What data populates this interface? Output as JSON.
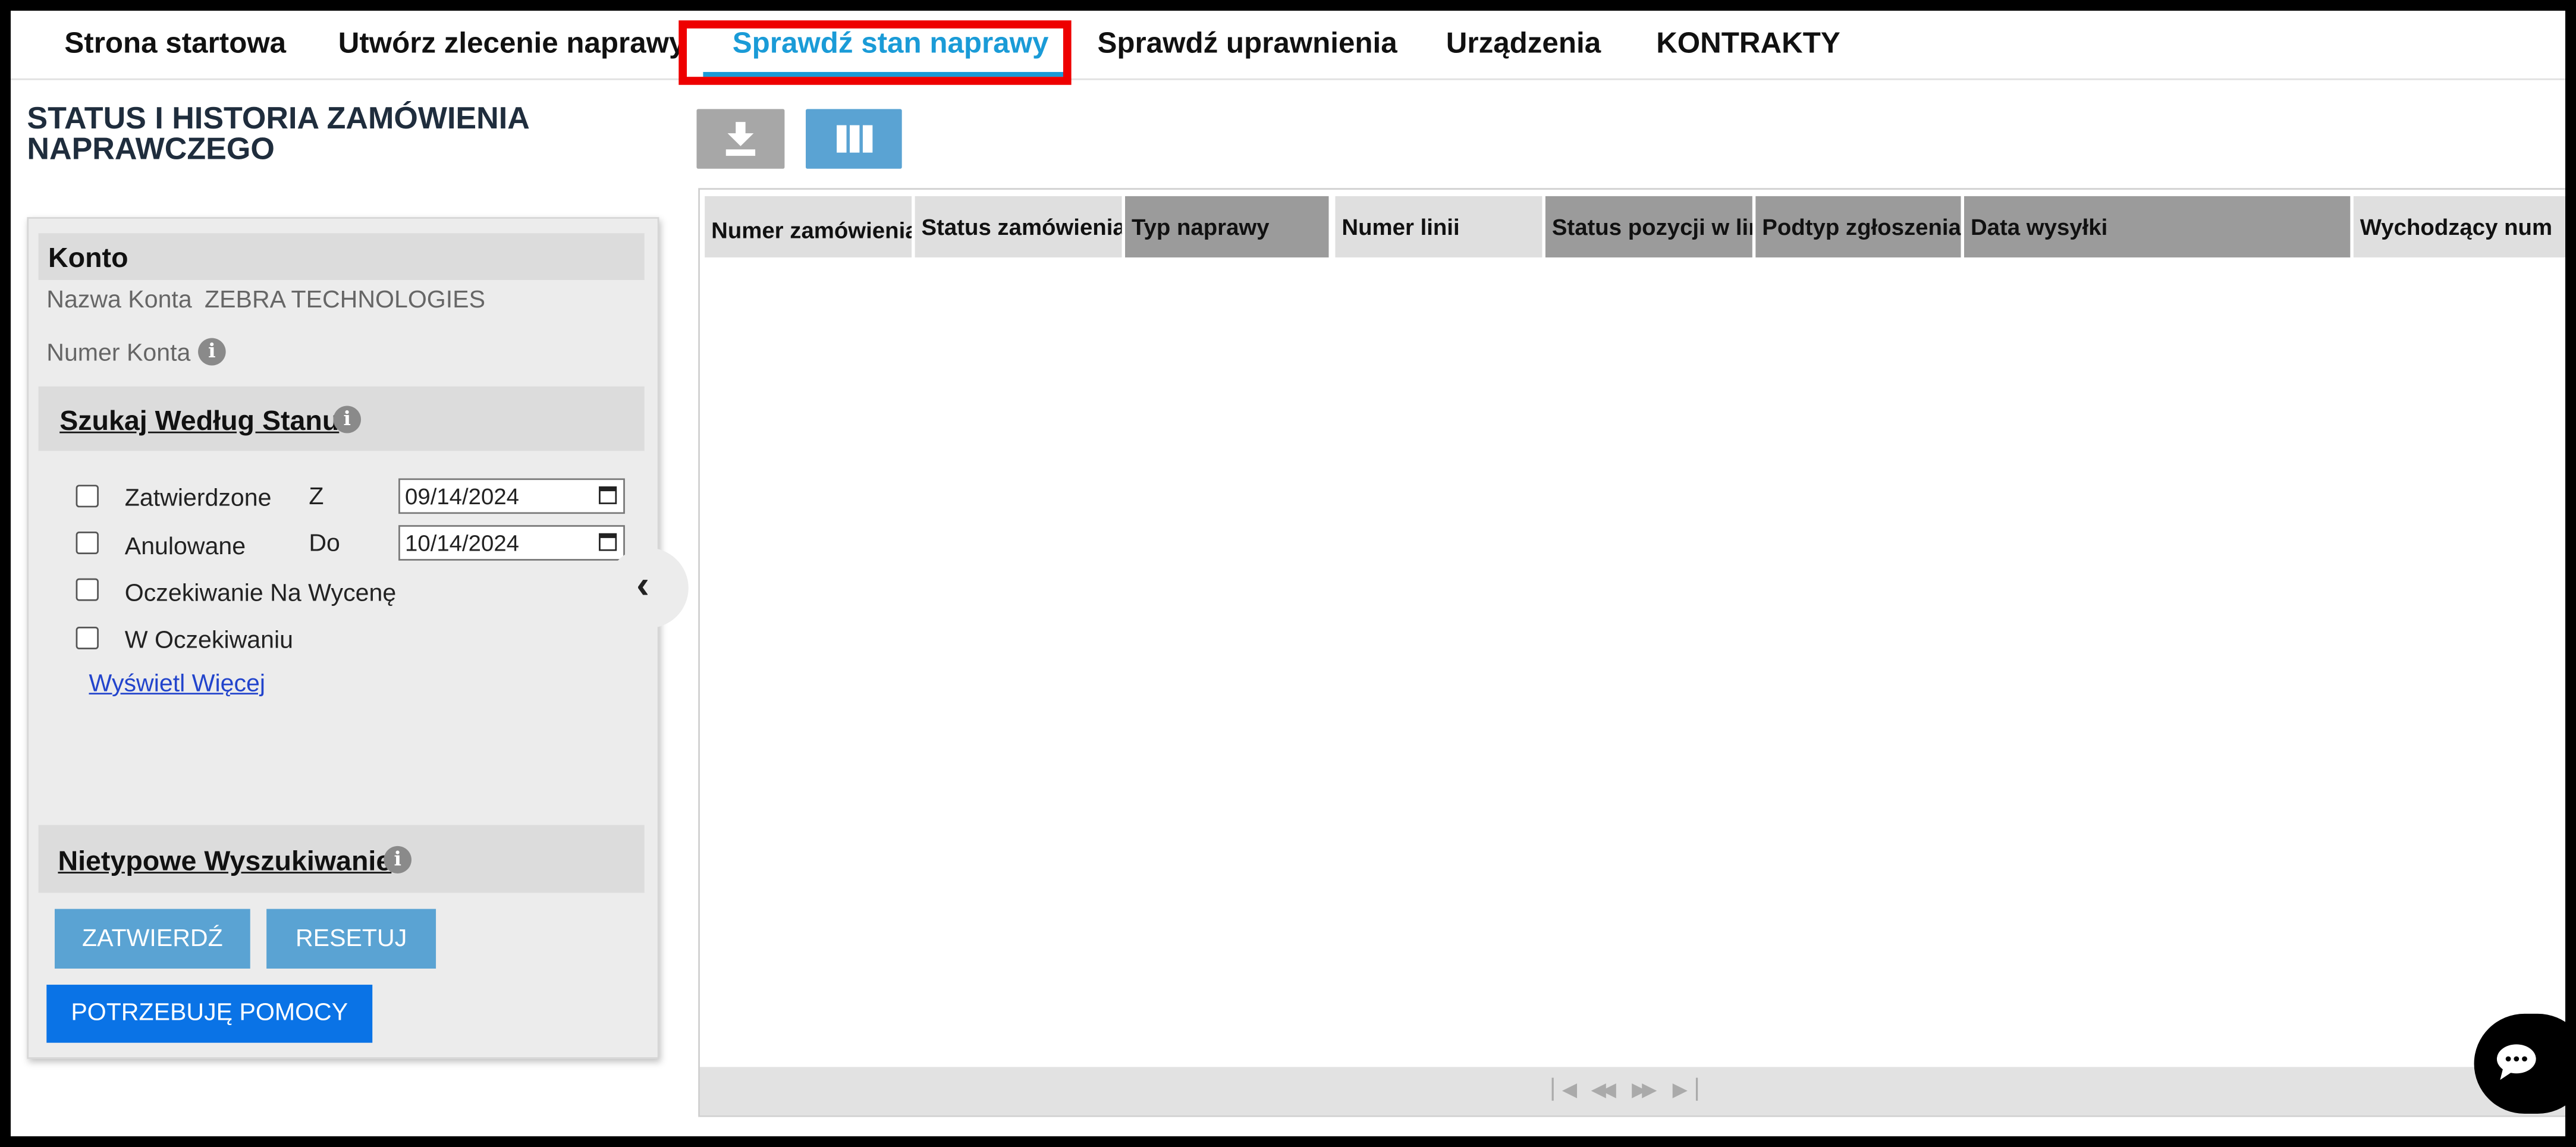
{
  "nav": {
    "items": [
      {
        "label": "Strona startowa",
        "active": false
      },
      {
        "label": "Utwórz zlecenie naprawy",
        "active": false
      },
      {
        "label": "Sprawdź stan naprawy",
        "active": true
      },
      {
        "label": "Sprawdź uprawnienia",
        "active": false
      },
      {
        "label": "Urządzenia",
        "active": false
      },
      {
        "label": "KONTRAKTY",
        "active": false
      }
    ],
    "highlight_color": "#ee0000",
    "active_color": "#1a9bd7"
  },
  "page": {
    "title": "STATUS I HISTORIA ZAMÓWIENIA NAPRAWCZEGO"
  },
  "panel": {
    "account": {
      "section_title": "Konto",
      "name_label": "Nazwa Konta",
      "name_value": "ZEBRA TECHNOLOGIES",
      "number_label": "Numer Konta",
      "info_icon": "info-icon"
    },
    "status_search": {
      "title": "Szukaj Według Stanu",
      "checkboxes": [
        {
          "label": "Zatwierdzone",
          "checked": false
        },
        {
          "label": "Anulowane",
          "checked": false
        },
        {
          "label": "Oczekiwanie Na Wycenę",
          "checked": false
        },
        {
          "label": "W Oczekiwaniu",
          "checked": false
        }
      ],
      "from_label": "Z",
      "from_value": "09/14/2024",
      "to_label": "Do",
      "to_value": "10/14/2024",
      "show_more": "Wyświetl Więcej"
    },
    "custom_search": {
      "title": "Nietypowe Wyszukiwanie"
    },
    "buttons": {
      "submit": "ZATWIERDŹ",
      "reset": "RESETUJ",
      "help": "POTRZEBUJĘ POMOCY"
    }
  },
  "toolbar": {
    "download_icon": "download-icon",
    "columns_icon": "columns-icon"
  },
  "grid": {
    "columns": [
      "Numer zamówienia",
      "Status zamówienia",
      "Typ naprawy",
      "Numer linii",
      "Status pozycji w lin",
      "Podtyp zgłoszenia p",
      "Data wysyłki",
      "Wychodzący num"
    ]
  }
}
